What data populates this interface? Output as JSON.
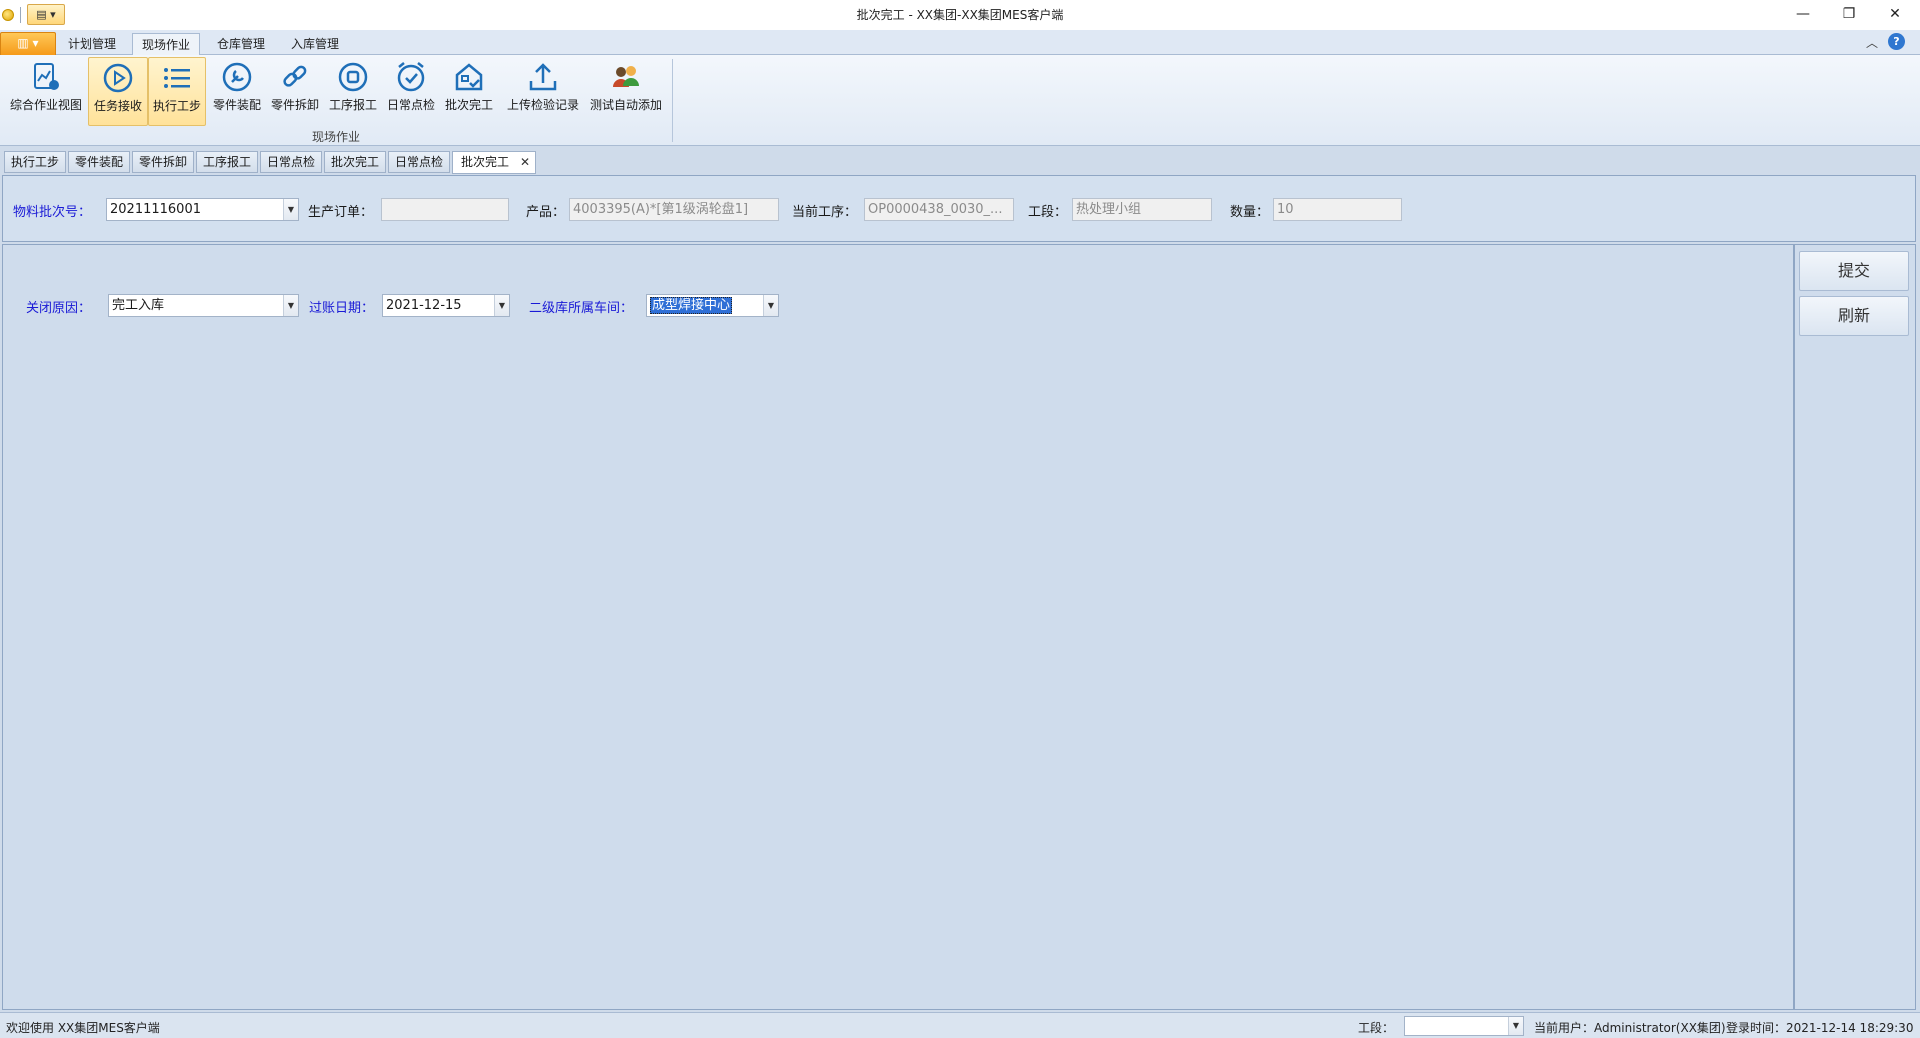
{
  "window": {
    "title": "批次完工 - XX集团-XX集团MES客户端",
    "minimize": "—",
    "restore": "❐",
    "close": "✕"
  },
  "ribbon_tabs": [
    "计划管理",
    "现场作业",
    "仓库管理",
    "入库管理"
  ],
  "ribbon_active_tab": "现场作业",
  "ribbon": {
    "group_label": "现场作业",
    "buttons": [
      {
        "label": "综合作业视图",
        "icon": "chart-document-icon"
      },
      {
        "label": "任务接收",
        "icon": "play-circle-icon"
      },
      {
        "label": "执行工步",
        "icon": "list-icon"
      },
      {
        "label": "零件装配",
        "icon": "wrench-icon"
      },
      {
        "label": "零件拆卸",
        "icon": "link-icon"
      },
      {
        "label": "工序报工",
        "icon": "stop-circle-icon"
      },
      {
        "label": "日常点检",
        "icon": "alarm-check-icon"
      },
      {
        "label": "批次完工",
        "icon": "house-check-icon"
      },
      {
        "label": "上传检验记录",
        "icon": "upload-icon"
      },
      {
        "label": "测试自动添加",
        "icon": "users-icon"
      }
    ]
  },
  "doc_tabs": [
    "执行工步",
    "零件装配",
    "零件拆卸",
    "工序报工",
    "日常点检",
    "批次完工",
    "日常点检",
    "批次完工"
  ],
  "header_form": {
    "batch_label": "物料批次号：",
    "batch_value": "20211116001",
    "order_label": "生产订单：",
    "order_value": "",
    "product_label": "产品：",
    "product_value": "4003395(A)*[第1级涡轮盘1]",
    "process_label": "当前工序：",
    "process_value": "OP0000438_0030_...",
    "section_label": "工段：",
    "section_value": "热处理小组",
    "qty_label": "数量：",
    "qty_value": "10"
  },
  "close_form": {
    "reason_label": "关闭原因：",
    "reason_value": "完工入库",
    "date_label": "过账日期：",
    "date_value": "2021-12-15",
    "workshop_label": "二级库所属车间：",
    "workshop_value": "成型焊接中心"
  },
  "actions": {
    "submit": "提交",
    "refresh": "刷新"
  },
  "status": {
    "welcome": "欢迎使用 XX集团MES客户端",
    "section_label": "工段：",
    "user": "当前用户：Administrator(XX集团)",
    "login_time": "登录时间：2021-12-14 18:29:30"
  }
}
